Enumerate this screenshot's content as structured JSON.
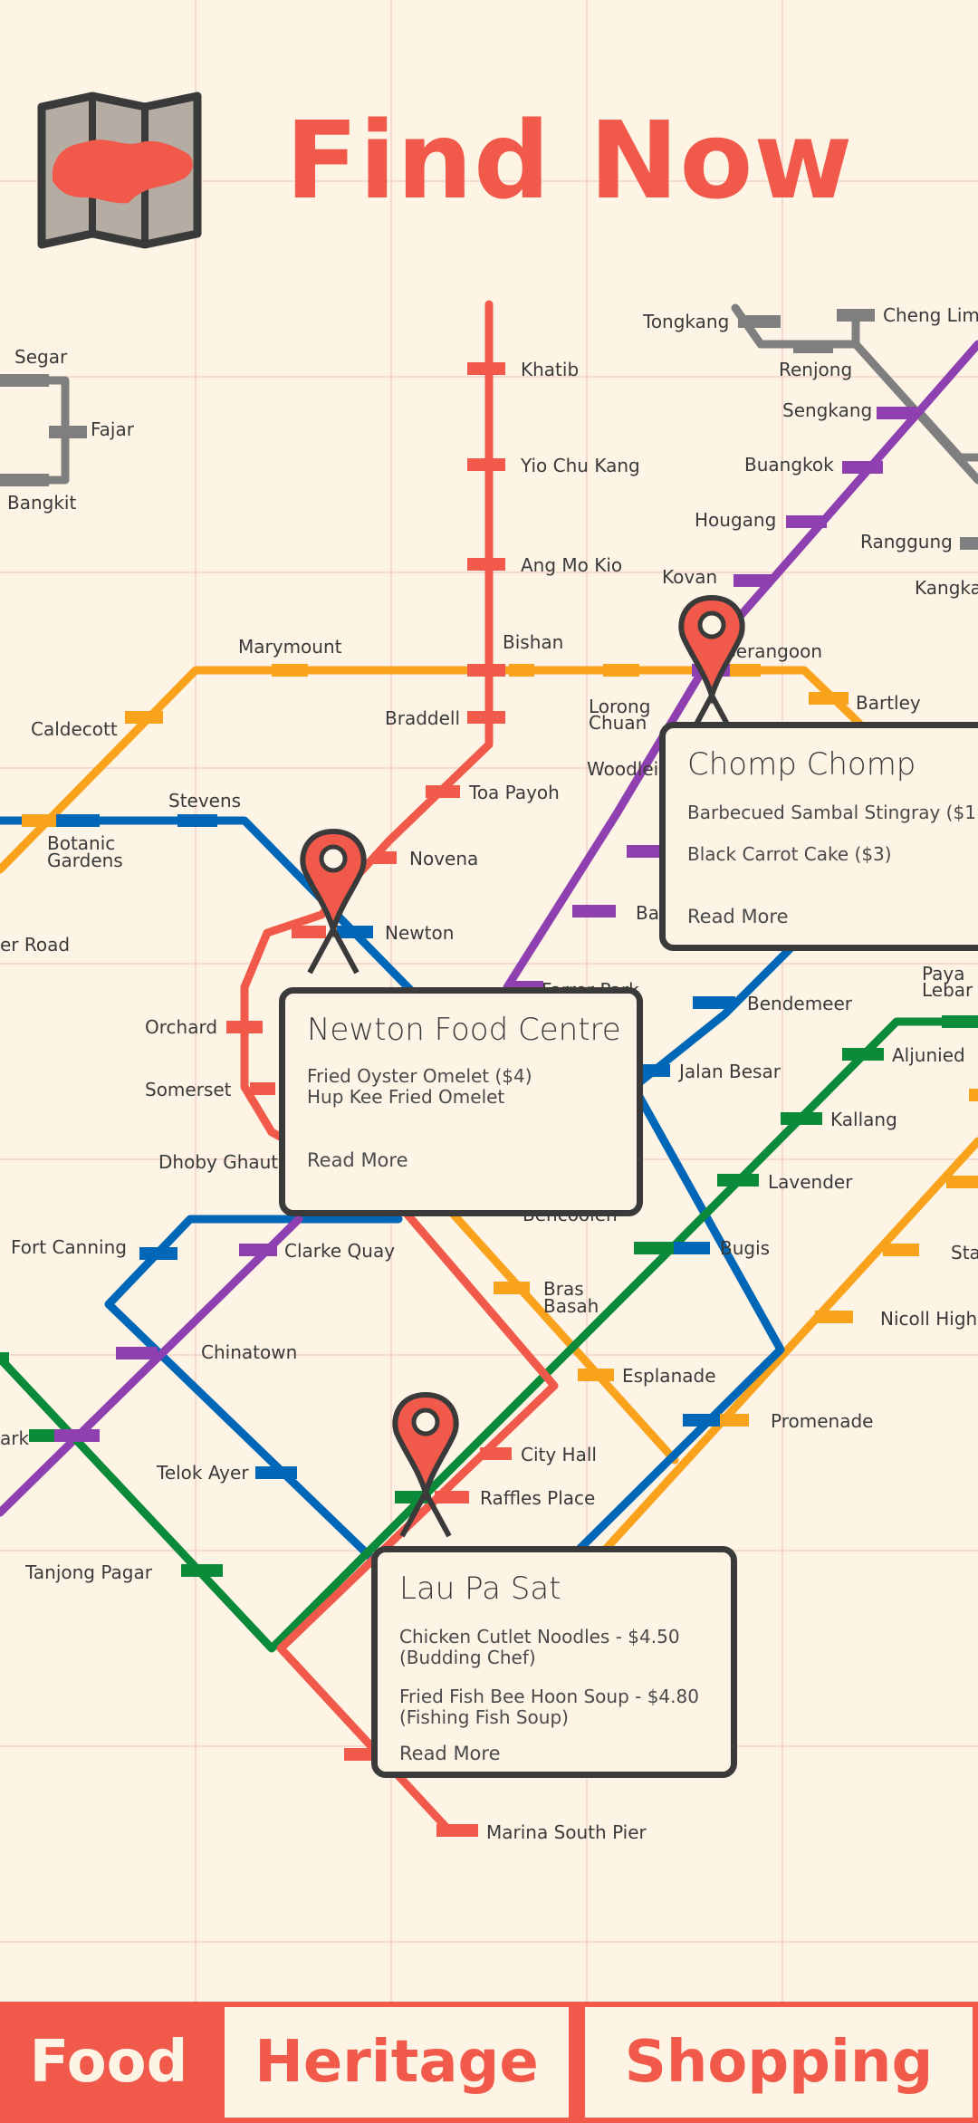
{
  "header": {
    "title": "Find Now",
    "logo_icon": "singapore-folded-map-icon"
  },
  "colors": {
    "accent": "#F15A4A",
    "background": "#FDF4E6",
    "north_south": "#F15A4A",
    "circle": "#F9A21B",
    "downtown": "#0067B8",
    "north_east": "#8E3FB0",
    "east_west": "#0B8A3A",
    "lrt": "#7F7F7F",
    "card_border": "#3a3a3a"
  },
  "stations": {
    "segar": "Segar",
    "fajar": "Fajar",
    "bangkit": "Bangkit",
    "khatib": "Khatib",
    "yio_chu_kang": "Yio Chu Kang",
    "ang_mo_kio": "Ang Mo Kio",
    "tongkang": "Tongkang",
    "cheng_lim": "Cheng Lim",
    "renjong": "Renjong",
    "sengkang": "Sengkang",
    "buangkok": "Buangkok",
    "hougang": "Hougang",
    "ranggung": "Ranggung",
    "kangkar": "Kangkar",
    "kovan": "Kovan",
    "serangoon": "Serangoon",
    "bishan": "Bishan",
    "marymount": "Marymount",
    "bartley": "Bartley",
    "caldecott": "Caldecott",
    "braddell": "Braddell",
    "lorong_chuan_1": "Lorong",
    "lorong_chuan_2": "Chuan",
    "woodleigh": "Woodleigh",
    "stevens": "Stevens",
    "botanic_1": "Botanic",
    "botanic_2": "Gardens",
    "toa_payoh": "Toa Payoh",
    "novena": "Novena",
    "newton": "Newton",
    "er_road": "er Road",
    "orchard": "Orchard",
    "somerset": "Somerset",
    "dhoby_ghaut": "Dhoby Ghaut",
    "bendemeer": "Bendemeer",
    "paya_lebar_1": "Paya",
    "paya_lebar_2": "Lebar",
    "aljunied": "Aljunied",
    "kallang": "Kallang",
    "jalan_besar": "Jalan Besar",
    "lavender": "Lavender",
    "fort_canning": "Fort Canning",
    "clarke_quay": "Clarke Quay",
    "bugis": "Bugis",
    "stadium": "Sta",
    "bras_basah_1": "Bras",
    "bras_basah_2": "Basah",
    "nicoll": "Nicoll Highw",
    "chinatown": "Chinatown",
    "esplanade": "Esplanade",
    "promenade": "Promenade",
    "ark": "ark",
    "telok_ayer": "Telok Ayer",
    "city_hall": "City Hall",
    "raffles_place": "Raffles Place",
    "tanjong_pagar": "Tanjong Pagar",
    "marina_south_pier": "Marina South Pier",
    "ba": "Ba",
    "farrer_park": "Farrer Park",
    "bencoolen": "Bencoolen"
  },
  "cards": [
    {
      "name": "Chomp Chomp",
      "items": [
        "Barbecued Sambal Stingray ($1",
        "Black Carrot Cake ($3)"
      ],
      "read_more": "Read More"
    },
    {
      "name": "Newton Food Centre",
      "items": [
        "Fried Oyster Omelet ($4)\nHup Kee Fried Omelet"
      ],
      "read_more": "Read More"
    },
    {
      "name": "Lau Pa Sat",
      "items": [
        "Chicken Cutlet Noodles - $4.50\n(Budding Chef)",
        "Fried Fish Bee Hoon Soup - $4.80\n(Fishing Fish Soup)"
      ],
      "read_more": "Read More"
    }
  ],
  "pin_icon": "map-pin-icon",
  "tabs": [
    {
      "label": "Food",
      "active": true
    },
    {
      "label": "Heritage",
      "active": false
    },
    {
      "label": "Shopping",
      "active": false
    }
  ]
}
